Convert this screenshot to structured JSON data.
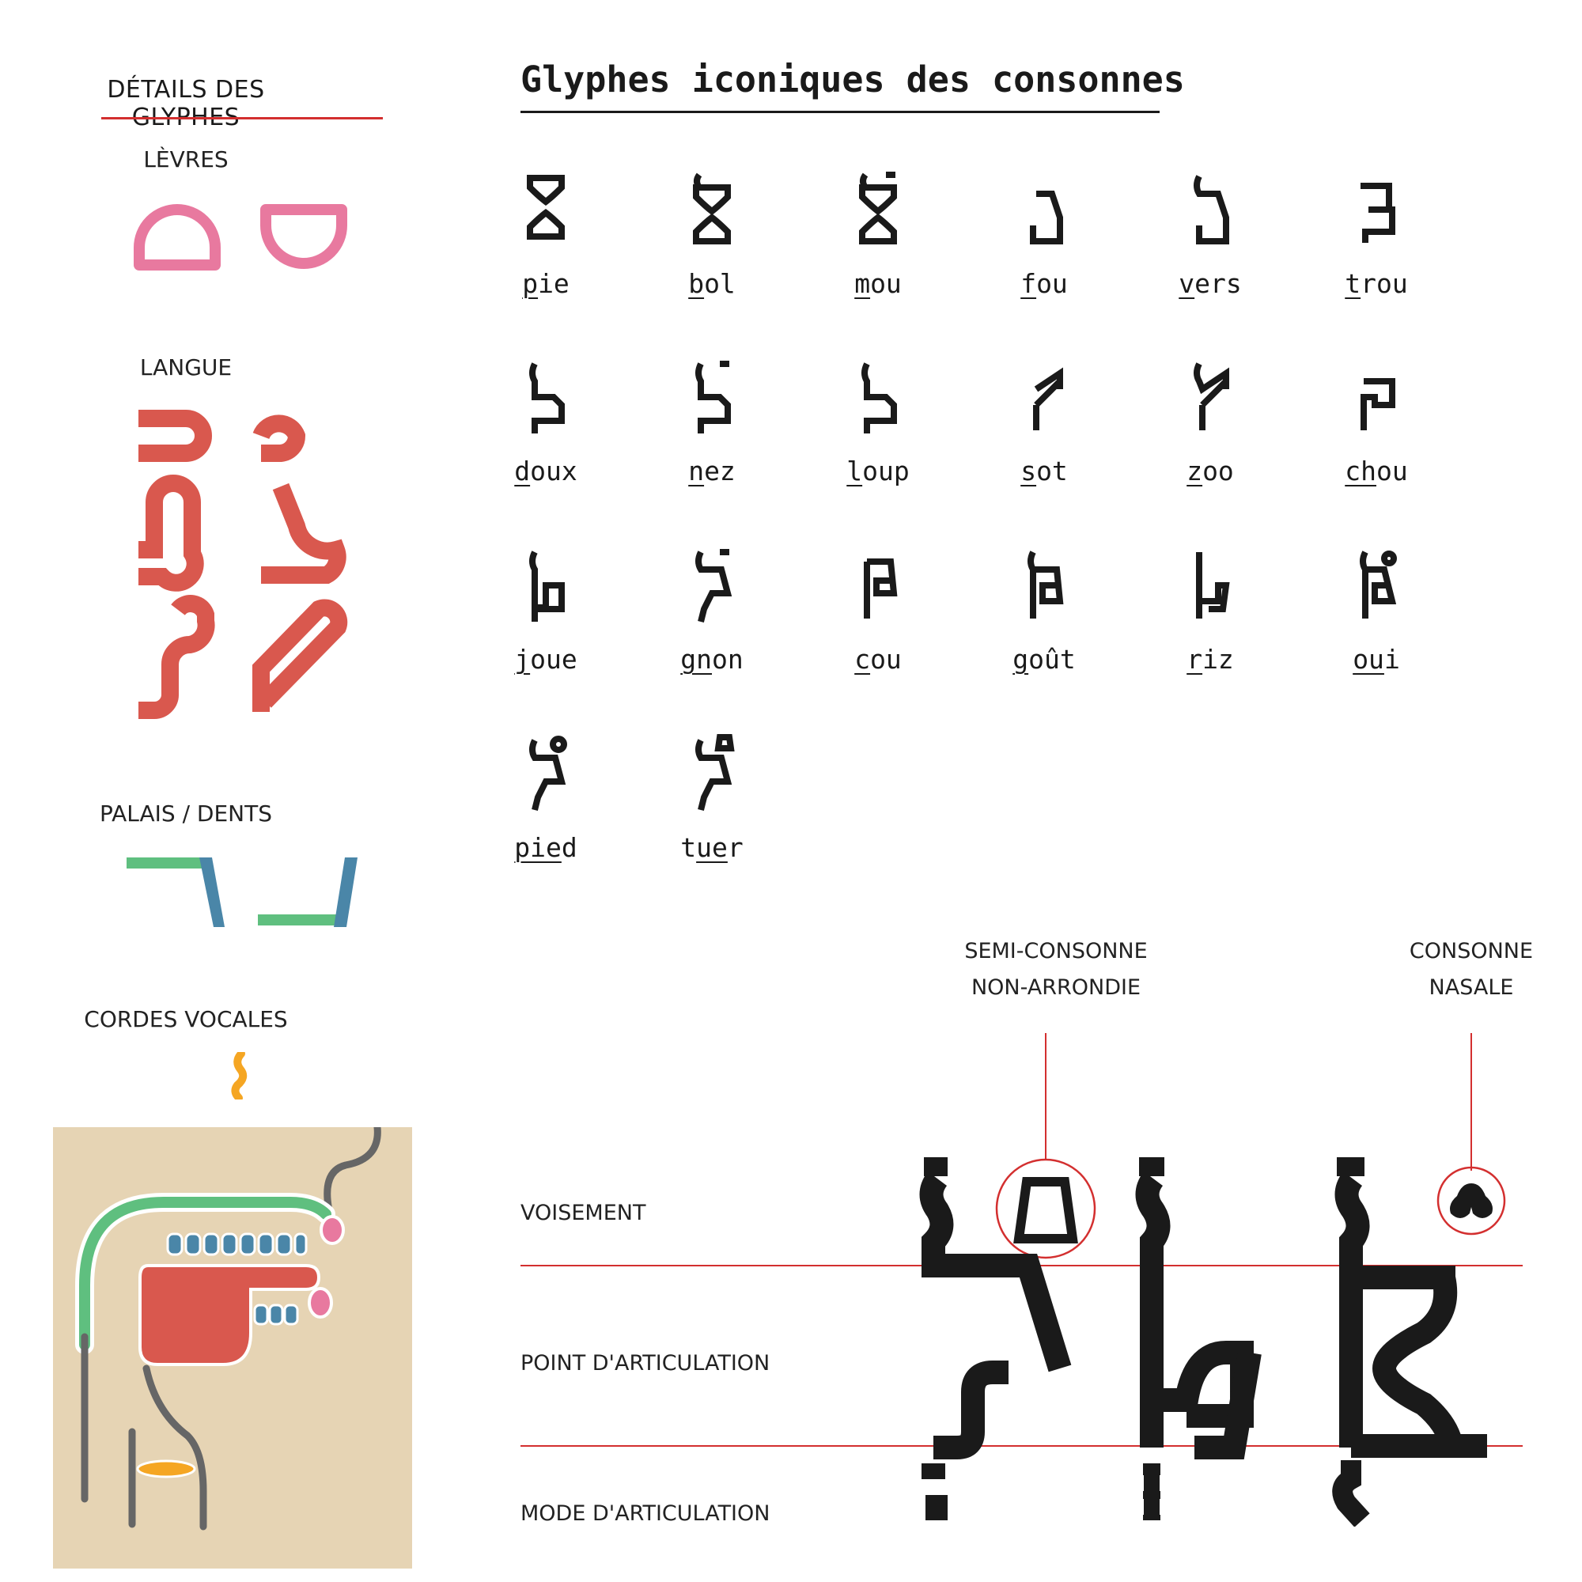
{
  "sidebar": {
    "title": "DÉTAILS DES GLYPHES",
    "sections": {
      "levres": "LÈVRES",
      "langue": "LANGUE",
      "palais": "PALAIS / DENTS",
      "cordes": "CORDES VOCALES"
    }
  },
  "main": {
    "title": "Glyphes iconiques des consonnes",
    "glyphs": [
      {
        "pre": "",
        "u": "p",
        "post": "ie"
      },
      {
        "pre": "",
        "u": "b",
        "post": "ol"
      },
      {
        "pre": "",
        "u": "m",
        "post": "ou"
      },
      {
        "pre": "",
        "u": "f",
        "post": "ou"
      },
      {
        "pre": "",
        "u": "v",
        "post": "ers"
      },
      {
        "pre": "",
        "u": "t",
        "post": "rou"
      },
      {
        "pre": "",
        "u": "d",
        "post": "oux"
      },
      {
        "pre": "",
        "u": "n",
        "post": "ez"
      },
      {
        "pre": "",
        "u": "l",
        "post": "oup"
      },
      {
        "pre": "",
        "u": "s",
        "post": "ot"
      },
      {
        "pre": "",
        "u": "z",
        "post": "oo"
      },
      {
        "pre": "",
        "u": "ch",
        "post": "ou"
      },
      {
        "pre": "",
        "u": "j",
        "post": "oue"
      },
      {
        "pre": "",
        "u": "gn",
        "post": "on"
      },
      {
        "pre": "",
        "u": "c",
        "post": "ou"
      },
      {
        "pre": "",
        "u": "g",
        "post": "oût"
      },
      {
        "pre": "",
        "u": "r",
        "post": "iz"
      },
      {
        "pre": "",
        "u": "ou",
        "post": "i"
      },
      {
        "pre": "",
        "u": "pie",
        "post": "d"
      },
      {
        "pre": "t",
        "u": "ue",
        "post": "r"
      }
    ]
  },
  "anatomy": {
    "rows": {
      "voisement": "VOISEMENT",
      "point": "POINT D'ARTICULATION",
      "mode": "MODE D'ARTICULATION"
    },
    "annotations": {
      "semi_line1": "SEMI-CONSONNE",
      "semi_line2": "NON-ARRONDIE",
      "nasal_line1": "CONSONNE",
      "nasal_line2": "NASALE"
    }
  },
  "colors": {
    "lips": "#e8799f",
    "tongue": "#d9584e",
    "palate": "#5fbf7f",
    "teeth": "#4a86a8",
    "vocal_cords": "#f5a623",
    "accent_red": "#d32f2f",
    "diagram_bg": "#e6d4b4"
  }
}
